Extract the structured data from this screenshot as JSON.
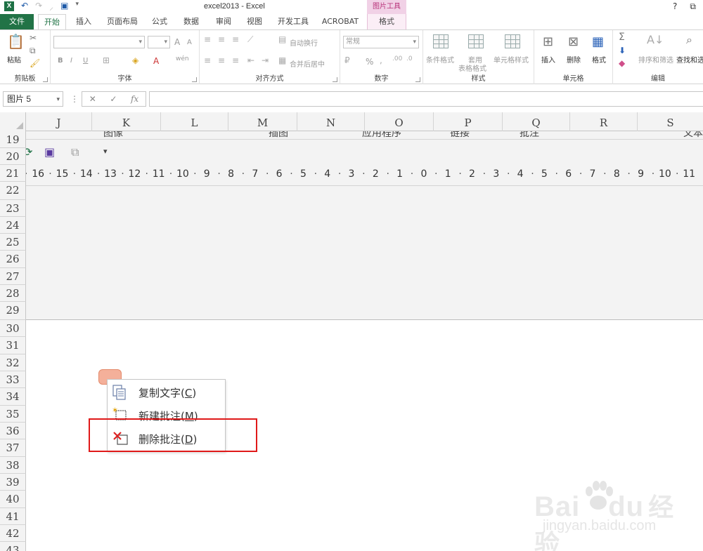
{
  "title_bar": {
    "app_icon": "X",
    "title": "excel2013 - Excel",
    "contextual_group": "图片工具",
    "help": "?",
    "restore_icon": "restore-icon"
  },
  "tabs": [
    "文件",
    "开始",
    "插入",
    "页面布局",
    "公式",
    "数据",
    "审阅",
    "视图",
    "开发工具",
    "ACROBAT",
    "格式"
  ],
  "ribbon": {
    "clipboard": {
      "label": "剪贴板",
      "paste": "粘贴"
    },
    "font": {
      "label": "字体",
      "grow": "A",
      "shrink": "A",
      "bold": "B",
      "italic": "I",
      "underline": "U",
      "font_color": "A",
      "phonetic": "wén"
    },
    "alignment": {
      "label": "对齐方式",
      "wrap": "自动换行",
      "merge": "合并后居中"
    },
    "number": {
      "label": "数字",
      "format": "常规",
      "percent": "%"
    },
    "styles": {
      "label": "样式",
      "conditional": "条件格式",
      "table_line1": "套用",
      "table_line2": "表格格式",
      "cell_styles": "单元格样式"
    },
    "cells": {
      "label": "单元格",
      "insert": "插入",
      "delete": "删除",
      "format": "格式"
    },
    "editing": {
      "label": "编辑",
      "sort": "排序和筛选",
      "find": "查找和选择"
    }
  },
  "formula_bar": {
    "name_box": "图片 5",
    "fx": "fx",
    "value": ""
  },
  "columns": [
    "J",
    "K",
    "L",
    "M",
    "N",
    "O",
    "P",
    "Q",
    "R",
    "S"
  ],
  "rows": [
    "19",
    "20",
    "21",
    "22",
    "23",
    "24",
    "25",
    "26",
    "27",
    "28",
    "29",
    "30",
    "31",
    "32",
    "33",
    "34",
    "35",
    "36",
    "37",
    "38",
    "39",
    "40",
    "41",
    "42",
    "43"
  ],
  "picture": {
    "header_strip": [
      "图像",
      "插图",
      "应用程序",
      "链接",
      "批注",
      "文本"
    ],
    "ruler": [
      "16",
      "15",
      "14",
      "13",
      "12",
      "11",
      "10",
      "9",
      "8",
      "7",
      "6",
      "5",
      "4",
      "3",
      "2",
      "1",
      "0",
      "1",
      "2",
      "3",
      "4",
      "5",
      "6",
      "7",
      "8",
      "9",
      "10",
      "11"
    ]
  },
  "context_menu": {
    "items": [
      {
        "label": "复制文字",
        "key": "C",
        "icon": "copy-text-icon"
      },
      {
        "label": "新建批注",
        "key": "M",
        "icon": "new-comment-icon"
      },
      {
        "label": "删除批注",
        "key": "D",
        "icon": "delete-comment-icon"
      }
    ]
  },
  "watermark": {
    "brand": "Bai",
    "brand2": "du",
    "cn": "经验",
    "url": "jingyan.baidu.com"
  },
  "colors": {
    "excel_green": "#217346",
    "context_pink": "#f1d1e6",
    "highlight_red": "#e01919",
    "shape_fill": "#f4b09a"
  }
}
